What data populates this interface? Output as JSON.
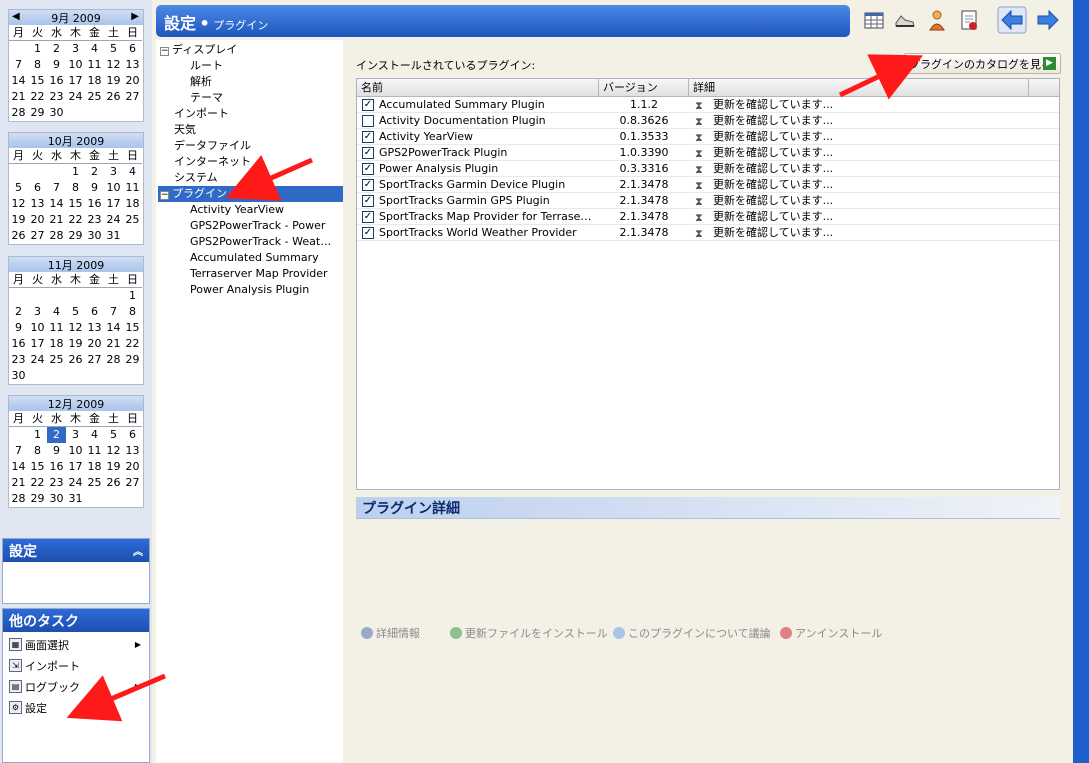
{
  "calendars": [
    {
      "title": "9月 2009",
      "days": [
        "",
        "1",
        "2",
        "3",
        "4",
        "5",
        "6",
        "7",
        "8",
        "9",
        "10",
        "11",
        "12",
        "13",
        "14",
        "15",
        "16",
        "17",
        "18",
        "19",
        "20",
        "21",
        "22",
        "23",
        "24",
        "25",
        "26",
        "27",
        "28",
        "29",
        "30"
      ],
      "selected": null
    },
    {
      "title": "10月 2009",
      "days": [
        "",
        "",
        "",
        "1",
        "2",
        "3",
        "4",
        "5",
        "6",
        "7",
        "8",
        "9",
        "10",
        "11",
        "12",
        "13",
        "14",
        "15",
        "16",
        "17",
        "18",
        "19",
        "20",
        "21",
        "22",
        "23",
        "24",
        "25",
        "26",
        "27",
        "28",
        "29",
        "30",
        "31"
      ],
      "selected": null
    },
    {
      "title": "11月 2009",
      "days": [
        "",
        "",
        "",
        "",
        "",
        "",
        "1",
        "2",
        "3",
        "4",
        "5",
        "6",
        "7",
        "8",
        "9",
        "10",
        "11",
        "12",
        "13",
        "14",
        "15",
        "16",
        "17",
        "18",
        "19",
        "20",
        "21",
        "22",
        "23",
        "24",
        "25",
        "26",
        "27",
        "28",
        "29",
        "30"
      ],
      "selected": null
    },
    {
      "title": "12月 2009",
      "days": [
        "",
        "1",
        "2",
        "3",
        "4",
        "5",
        "6",
        "7",
        "8",
        "9",
        "10",
        "11",
        "12",
        "13",
        "14",
        "15",
        "16",
        "17",
        "18",
        "19",
        "20",
        "21",
        "22",
        "23",
        "24",
        "25",
        "26",
        "27",
        "28",
        "29",
        "30",
        "31"
      ],
      "selected": "2"
    }
  ],
  "weekdays": [
    "月",
    "火",
    "水",
    "木",
    "金",
    "土",
    "日"
  ],
  "settings_panel": {
    "title": "設定"
  },
  "tasks_panel": {
    "title": "他のタスク",
    "items": [
      {
        "label": "画面選択",
        "has_arrow": true
      },
      {
        "label": "インポート",
        "has_arrow": false
      },
      {
        "label": "ログブック",
        "has_arrow": true
      },
      {
        "label": "設定",
        "has_arrow": false
      }
    ]
  },
  "header": {
    "title": "設定",
    "bullet": "•",
    "subtitle": "プラグイン"
  },
  "toolbar_icons": [
    "calendar-grid-icon",
    "shoe-icon",
    "athlete-icon",
    "report-icon",
    "back-arrow-icon",
    "forward-arrow-icon"
  ],
  "tree": [
    {
      "label": "ディスプレイ",
      "level": 0,
      "expander": "⊟"
    },
    {
      "label": "ルート",
      "level": 1
    },
    {
      "label": "解析",
      "level": 1
    },
    {
      "label": "テーマ",
      "level": 1
    },
    {
      "label": "インポート",
      "level": 0
    },
    {
      "label": "天気",
      "level": 0
    },
    {
      "label": "データファイル",
      "level": 0
    },
    {
      "label": "インターネット",
      "level": 0
    },
    {
      "label": "システム",
      "level": 0
    },
    {
      "label": "プラグイン",
      "level": 0,
      "expander": "⊟",
      "selected": true
    },
    {
      "label": "Activity YearView",
      "level": 1
    },
    {
      "label": "GPS2PowerTrack - Power",
      "level": 1
    },
    {
      "label": "GPS2PowerTrack - Weat…",
      "level": 1
    },
    {
      "label": "Accumulated Summary",
      "level": 1
    },
    {
      "label": "Terraserver Map Provider",
      "level": 1
    },
    {
      "label": "Power Analysis Plugin",
      "level": 1
    }
  ],
  "installed_label": "インストールされているプラグイン:",
  "catalog_button": "プラグインのカタログを見る",
  "columns": [
    "名前",
    "バージョン",
    "詳細"
  ],
  "plugins": [
    {
      "name": "Accumulated Summary Plugin",
      "version": "1.1.2",
      "checked": true,
      "status": "更新を確認しています..."
    },
    {
      "name": "Activity Documentation Plugin",
      "version": "0.8.3626",
      "checked": false,
      "status": "更新を確認しています..."
    },
    {
      "name": "Activity YearView",
      "version": "0.1.3533",
      "checked": true,
      "status": "更新を確認しています..."
    },
    {
      "name": "GPS2PowerTrack Plugin",
      "version": "1.0.3390",
      "checked": true,
      "status": "更新を確認しています..."
    },
    {
      "name": "Power Analysis Plugin",
      "version": "0.3.3316",
      "checked": true,
      "status": "更新を確認しています..."
    },
    {
      "name": "SportTracks Garmin Device Plugin",
      "version": "2.1.3478",
      "checked": true,
      "status": "更新を確認しています..."
    },
    {
      "name": "SportTracks Garmin GPS Plugin",
      "version": "2.1.3478",
      "checked": true,
      "status": "更新を確認しています..."
    },
    {
      "name": "SportTracks Map Provider for Terrase…",
      "version": "2.1.3478",
      "checked": true,
      "status": "更新を確認しています..."
    },
    {
      "name": "SportTracks World Weather Provider",
      "version": "2.1.3478",
      "checked": true,
      "status": "更新を確認しています..."
    }
  ],
  "detail_title": "プラグイン詳細",
  "actions": [
    {
      "label": "詳細情報",
      "icon": "info-icon",
      "color": "#9aa9c8"
    },
    {
      "label": "更新ファイルをインストール",
      "icon": "install-icon",
      "color": "#8cc08c"
    },
    {
      "label": "このプラグインについて議論",
      "icon": "discuss-icon",
      "color": "#a8c4e6"
    },
    {
      "label": "アンインストール",
      "icon": "uninstall-icon",
      "color": "#e08080"
    }
  ]
}
